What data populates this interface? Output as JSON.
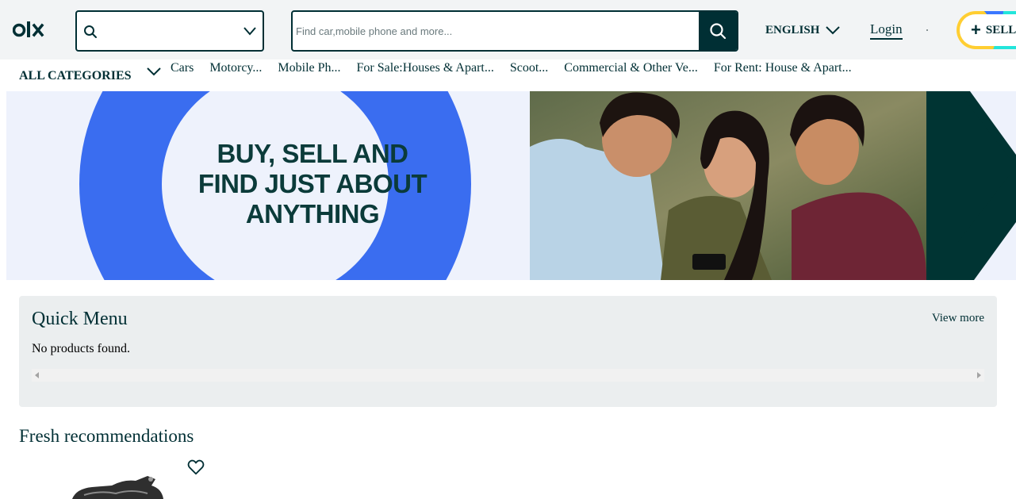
{
  "header": {
    "logo_text": "olx",
    "location_value": "",
    "search_placeholder": "Find car,mobile phone and more...",
    "language": "ENGLISH",
    "login_label": "Login",
    "sell_label": "SELL"
  },
  "categories": {
    "all_label": "ALL CATEGORIES",
    "items": [
      "Cars",
      "Motorcy...",
      "Mobile Ph...",
      "For Sale:Houses & Apart...",
      "Scoot...",
      "Commercial & Other Ve...",
      "For Rent: House & Apart..."
    ]
  },
  "banner": {
    "line1": "BUY, SELL AND",
    "line2": "FIND JUST ABOUT",
    "line3": "ANYTHING"
  },
  "quick_menu": {
    "title": "Quick Menu",
    "view_more": "View more",
    "empty_message": "No products found."
  },
  "fresh": {
    "title": "Fresh recommendations"
  },
  "colors": {
    "brand_dark": "#002f34",
    "banner_blue": "#3a6df0",
    "banner_bg": "#eef2fc",
    "panel_bg": "#ebeeef",
    "sell_yellow": "#ffce32",
    "sell_teal": "#23e5db",
    "sell_blue": "#3a77ff"
  },
  "icons": [
    "olx-logo",
    "search-icon",
    "chevron-down-icon",
    "plus-icon",
    "heart-icon"
  ]
}
